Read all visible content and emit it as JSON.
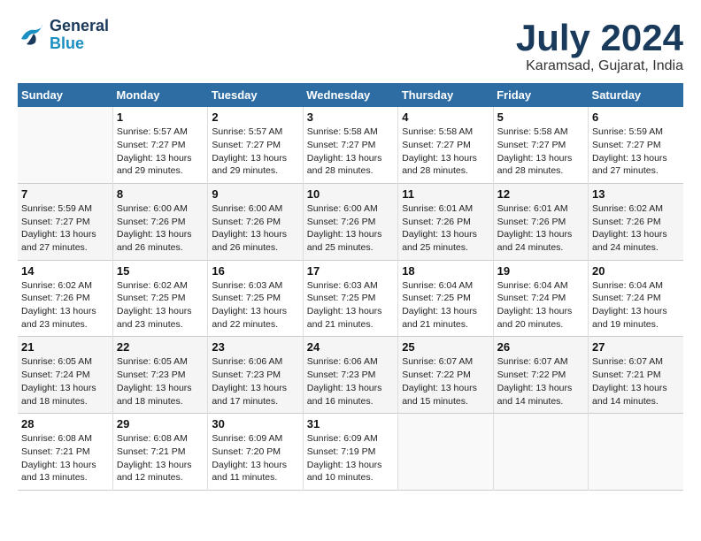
{
  "logo": {
    "line1": "General",
    "line2": "Blue"
  },
  "title": "July 2024",
  "location": "Karamsad, Gujarat, India",
  "days_header": [
    "Sunday",
    "Monday",
    "Tuesday",
    "Wednesday",
    "Thursday",
    "Friday",
    "Saturday"
  ],
  "weeks": [
    [
      {
        "day": "",
        "info": ""
      },
      {
        "day": "1",
        "info": "Sunrise: 5:57 AM\nSunset: 7:27 PM\nDaylight: 13 hours\nand 29 minutes."
      },
      {
        "day": "2",
        "info": "Sunrise: 5:57 AM\nSunset: 7:27 PM\nDaylight: 13 hours\nand 29 minutes."
      },
      {
        "day": "3",
        "info": "Sunrise: 5:58 AM\nSunset: 7:27 PM\nDaylight: 13 hours\nand 28 minutes."
      },
      {
        "day": "4",
        "info": "Sunrise: 5:58 AM\nSunset: 7:27 PM\nDaylight: 13 hours\nand 28 minutes."
      },
      {
        "day": "5",
        "info": "Sunrise: 5:58 AM\nSunset: 7:27 PM\nDaylight: 13 hours\nand 28 minutes."
      },
      {
        "day": "6",
        "info": "Sunrise: 5:59 AM\nSunset: 7:27 PM\nDaylight: 13 hours\nand 27 minutes."
      }
    ],
    [
      {
        "day": "7",
        "info": "Sunrise: 5:59 AM\nSunset: 7:27 PM\nDaylight: 13 hours\nand 27 minutes."
      },
      {
        "day": "8",
        "info": "Sunrise: 6:00 AM\nSunset: 7:26 PM\nDaylight: 13 hours\nand 26 minutes."
      },
      {
        "day": "9",
        "info": "Sunrise: 6:00 AM\nSunset: 7:26 PM\nDaylight: 13 hours\nand 26 minutes."
      },
      {
        "day": "10",
        "info": "Sunrise: 6:00 AM\nSunset: 7:26 PM\nDaylight: 13 hours\nand 25 minutes."
      },
      {
        "day": "11",
        "info": "Sunrise: 6:01 AM\nSunset: 7:26 PM\nDaylight: 13 hours\nand 25 minutes."
      },
      {
        "day": "12",
        "info": "Sunrise: 6:01 AM\nSunset: 7:26 PM\nDaylight: 13 hours\nand 24 minutes."
      },
      {
        "day": "13",
        "info": "Sunrise: 6:02 AM\nSunset: 7:26 PM\nDaylight: 13 hours\nand 24 minutes."
      }
    ],
    [
      {
        "day": "14",
        "info": "Sunrise: 6:02 AM\nSunset: 7:26 PM\nDaylight: 13 hours\nand 23 minutes."
      },
      {
        "day": "15",
        "info": "Sunrise: 6:02 AM\nSunset: 7:25 PM\nDaylight: 13 hours\nand 23 minutes."
      },
      {
        "day": "16",
        "info": "Sunrise: 6:03 AM\nSunset: 7:25 PM\nDaylight: 13 hours\nand 22 minutes."
      },
      {
        "day": "17",
        "info": "Sunrise: 6:03 AM\nSunset: 7:25 PM\nDaylight: 13 hours\nand 21 minutes."
      },
      {
        "day": "18",
        "info": "Sunrise: 6:04 AM\nSunset: 7:25 PM\nDaylight: 13 hours\nand 21 minutes."
      },
      {
        "day": "19",
        "info": "Sunrise: 6:04 AM\nSunset: 7:24 PM\nDaylight: 13 hours\nand 20 minutes."
      },
      {
        "day": "20",
        "info": "Sunrise: 6:04 AM\nSunset: 7:24 PM\nDaylight: 13 hours\nand 19 minutes."
      }
    ],
    [
      {
        "day": "21",
        "info": "Sunrise: 6:05 AM\nSunset: 7:24 PM\nDaylight: 13 hours\nand 18 minutes."
      },
      {
        "day": "22",
        "info": "Sunrise: 6:05 AM\nSunset: 7:23 PM\nDaylight: 13 hours\nand 18 minutes."
      },
      {
        "day": "23",
        "info": "Sunrise: 6:06 AM\nSunset: 7:23 PM\nDaylight: 13 hours\nand 17 minutes."
      },
      {
        "day": "24",
        "info": "Sunrise: 6:06 AM\nSunset: 7:23 PM\nDaylight: 13 hours\nand 16 minutes."
      },
      {
        "day": "25",
        "info": "Sunrise: 6:07 AM\nSunset: 7:22 PM\nDaylight: 13 hours\nand 15 minutes."
      },
      {
        "day": "26",
        "info": "Sunrise: 6:07 AM\nSunset: 7:22 PM\nDaylight: 13 hours\nand 14 minutes."
      },
      {
        "day": "27",
        "info": "Sunrise: 6:07 AM\nSunset: 7:21 PM\nDaylight: 13 hours\nand 14 minutes."
      }
    ],
    [
      {
        "day": "28",
        "info": "Sunrise: 6:08 AM\nSunset: 7:21 PM\nDaylight: 13 hours\nand 13 minutes."
      },
      {
        "day": "29",
        "info": "Sunrise: 6:08 AM\nSunset: 7:21 PM\nDaylight: 13 hours\nand 12 minutes."
      },
      {
        "day": "30",
        "info": "Sunrise: 6:09 AM\nSunset: 7:20 PM\nDaylight: 13 hours\nand 11 minutes."
      },
      {
        "day": "31",
        "info": "Sunrise: 6:09 AM\nSunset: 7:19 PM\nDaylight: 13 hours\nand 10 minutes."
      },
      {
        "day": "",
        "info": ""
      },
      {
        "day": "",
        "info": ""
      },
      {
        "day": "",
        "info": ""
      }
    ]
  ]
}
